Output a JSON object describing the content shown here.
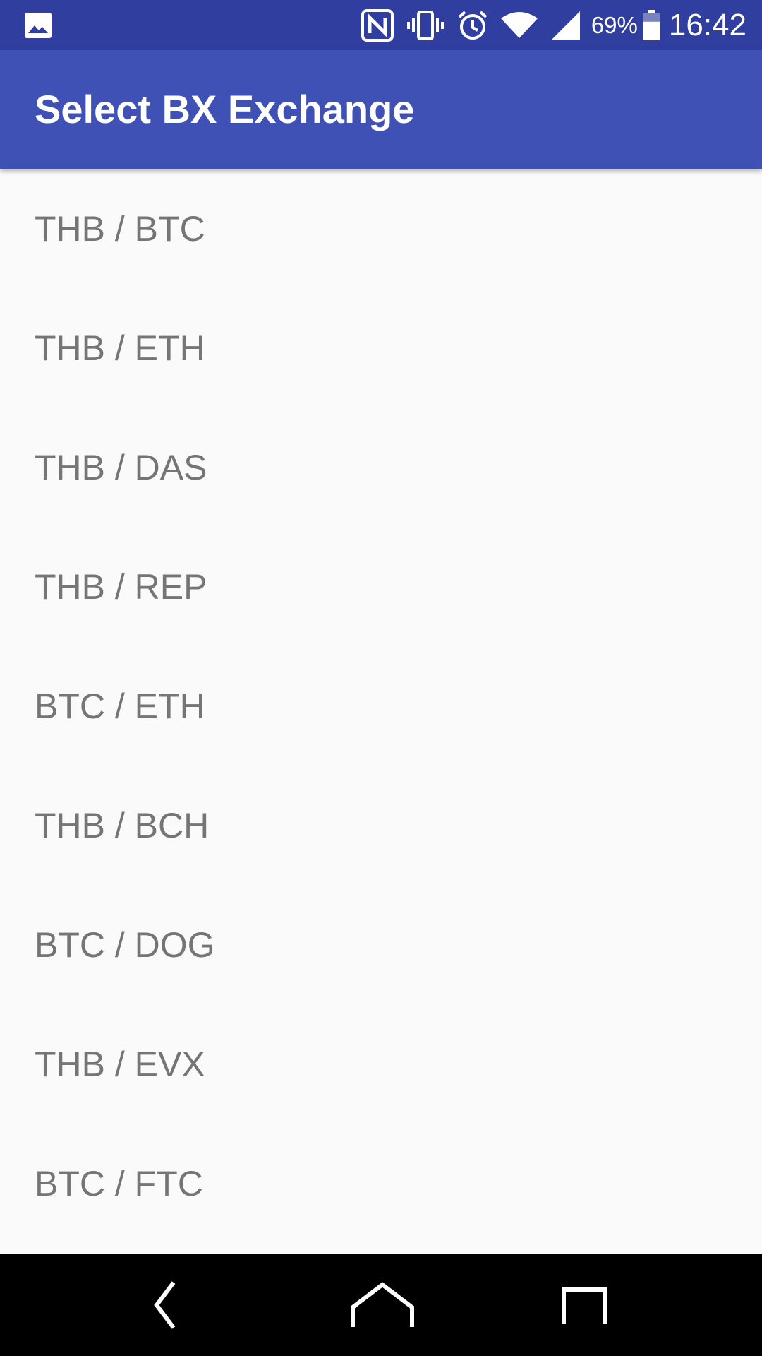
{
  "status_bar": {
    "icons": [
      "gallery-icon",
      "nfc-icon",
      "vibrate-icon",
      "alarm-icon",
      "wifi-icon",
      "cell-signal-icon",
      "battery-icon"
    ],
    "battery_percent": "69%",
    "battery_level": 0.69,
    "time": "16:42",
    "color": "#303f9f"
  },
  "app_bar": {
    "title": "Select BX Exchange",
    "color": "#3f51b5"
  },
  "pairs": [
    {
      "label": "THB / BTC"
    },
    {
      "label": "THB / ETH"
    },
    {
      "label": "THB / DAS"
    },
    {
      "label": "THB / REP"
    },
    {
      "label": "BTC / ETH"
    },
    {
      "label": "THB / BCH"
    },
    {
      "label": "BTC / DOG"
    },
    {
      "label": "THB / EVX"
    },
    {
      "label": "BTC / FTC"
    }
  ],
  "nav_bar": {
    "buttons": [
      "back-icon",
      "home-icon",
      "recents-icon"
    ]
  }
}
